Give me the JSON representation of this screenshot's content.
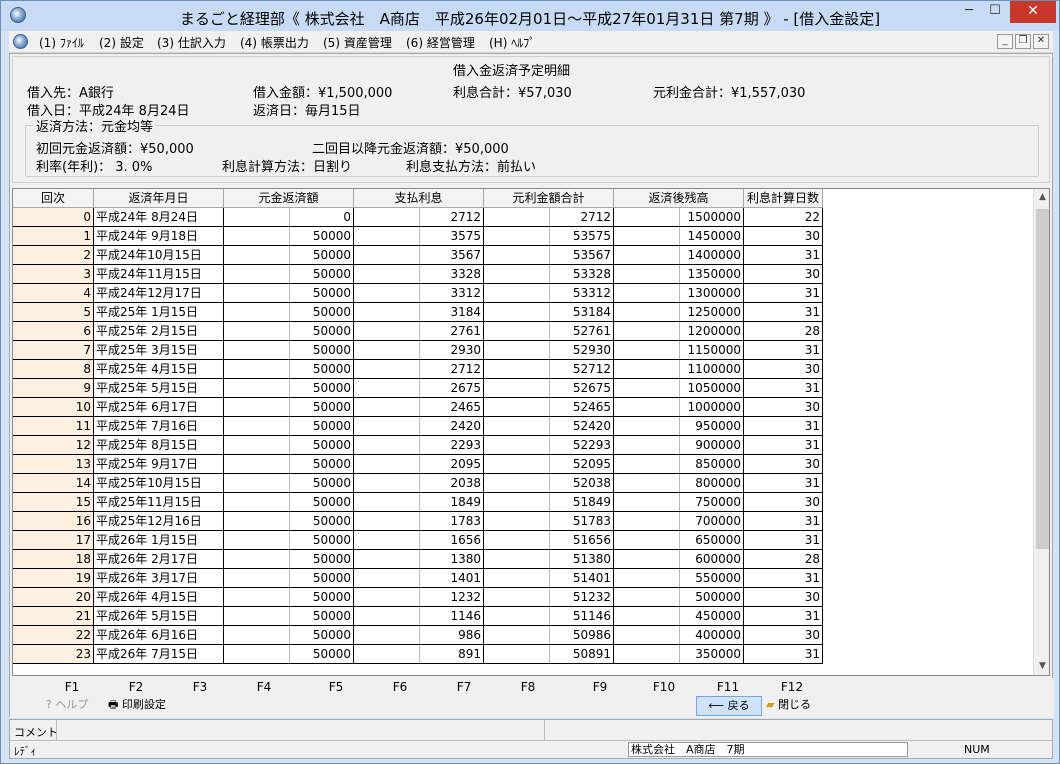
{
  "window": {
    "title": "まるごと経理部《 株式会社　A商店　平成26年02月01日～平成27年01月31日 第7期 》 - [借入金設定]",
    "min": "─",
    "max": "☐",
    "close": "✕"
  },
  "menu": [
    {
      "key": "(1)",
      "label": "ﾌｧｲﾙ"
    },
    {
      "key": "(2)",
      "label": "設定"
    },
    {
      "key": "(3)",
      "label": "仕訳入力"
    },
    {
      "key": "(4)",
      "label": "帳票出力"
    },
    {
      "key": "(5)",
      "label": "資産管理"
    },
    {
      "key": "(6)",
      "label": "経営管理"
    },
    {
      "key": "(H)",
      "label": "ﾍﾙﾌﾟ"
    }
  ],
  "mdi": {
    "min": "_",
    "restore": "❐",
    "close": "✕"
  },
  "info": {
    "section_title": "借入金返済予定明細",
    "lender": "借入先：A銀行",
    "amount": "借入金額：¥1,500,000",
    "interest_total": "利息合計：¥57,030",
    "principal_interest_total": "元利金合計：¥1,557,030",
    "borrow_date": "借入日：平成24年 8月24日",
    "repay_date": "返済日：毎月15日",
    "method": "返済方法：元金均等",
    "first_principal": "初回元金返済額：¥50,000",
    "second_principal": "二回目以降元金返済額：¥50,000",
    "rate": "利率(年利)： 3. 0%",
    "calc_method": "利息計算方法：日割り",
    "pay_method": "利息支払方法：前払い"
  },
  "table": {
    "columns": [
      "回次",
      "返済年月日",
      "元金返済額",
      "支払利息",
      "元利金額合計",
      "返済後残高",
      "利息計算日数"
    ],
    "rows": [
      [
        "0",
        "平成24年 8月24日",
        "0",
        "2712",
        "2712",
        "1500000",
        "22"
      ],
      [
        "1",
        "平成24年 9月18日",
        "50000",
        "3575",
        "53575",
        "1450000",
        "30"
      ],
      [
        "2",
        "平成24年10月15日",
        "50000",
        "3567",
        "53567",
        "1400000",
        "31"
      ],
      [
        "3",
        "平成24年11月15日",
        "50000",
        "3328",
        "53328",
        "1350000",
        "30"
      ],
      [
        "4",
        "平成24年12月17日",
        "50000",
        "3312",
        "53312",
        "1300000",
        "31"
      ],
      [
        "5",
        "平成25年 1月15日",
        "50000",
        "3184",
        "53184",
        "1250000",
        "31"
      ],
      [
        "6",
        "平成25年 2月15日",
        "50000",
        "2761",
        "52761",
        "1200000",
        "28"
      ],
      [
        "7",
        "平成25年 3月15日",
        "50000",
        "2930",
        "52930",
        "1150000",
        "31"
      ],
      [
        "8",
        "平成25年 4月15日",
        "50000",
        "2712",
        "52712",
        "1100000",
        "30"
      ],
      [
        "9",
        "平成25年 5月15日",
        "50000",
        "2675",
        "52675",
        "1050000",
        "31"
      ],
      [
        "10",
        "平成25年 6月17日",
        "50000",
        "2465",
        "52465",
        "1000000",
        "30"
      ],
      [
        "11",
        "平成25年 7月16日",
        "50000",
        "2420",
        "52420",
        "950000",
        "31"
      ],
      [
        "12",
        "平成25年 8月15日",
        "50000",
        "2293",
        "52293",
        "900000",
        "31"
      ],
      [
        "13",
        "平成25年 9月17日",
        "50000",
        "2095",
        "52095",
        "850000",
        "30"
      ],
      [
        "14",
        "平成25年10月15日",
        "50000",
        "2038",
        "52038",
        "800000",
        "31"
      ],
      [
        "15",
        "平成25年11月15日",
        "50000",
        "1849",
        "51849",
        "750000",
        "30"
      ],
      [
        "16",
        "平成25年12月16日",
        "50000",
        "1783",
        "51783",
        "700000",
        "31"
      ],
      [
        "17",
        "平成26年 1月15日",
        "50000",
        "1656",
        "51656",
        "650000",
        "31"
      ],
      [
        "18",
        "平成26年 2月17日",
        "50000",
        "1380",
        "51380",
        "600000",
        "28"
      ],
      [
        "19",
        "平成26年 3月17日",
        "50000",
        "1401",
        "51401",
        "550000",
        "31"
      ],
      [
        "20",
        "平成26年 4月15日",
        "50000",
        "1232",
        "51232",
        "500000",
        "30"
      ],
      [
        "21",
        "平成26年 5月15日",
        "50000",
        "1146",
        "51146",
        "450000",
        "31"
      ],
      [
        "22",
        "平成26年 6月16日",
        "50000",
        "986",
        "50986",
        "400000",
        "30"
      ],
      [
        "23",
        "平成26年 7月15日",
        "50000",
        "891",
        "50891",
        "350000",
        "31"
      ]
    ]
  },
  "fkeys": [
    "F1",
    "F2",
    "F3",
    "F4",
    "F5",
    "F6",
    "F7",
    "F8",
    "F9",
    "F10",
    "F11",
    "F12"
  ],
  "buttons": {
    "help": "ヘルプ",
    "print": "印刷設定",
    "back": "戻る",
    "close": "閉じる"
  },
  "status": {
    "comment_label": "コメント",
    "ready": "ﾚﾃﾞｨ",
    "company": "株式会社　A商店　7期",
    "num": "NUM"
  }
}
